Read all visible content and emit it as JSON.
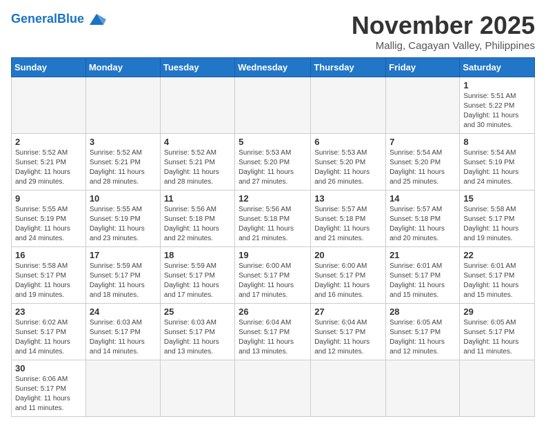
{
  "header": {
    "logo_general": "General",
    "logo_blue": "Blue",
    "month_title": "November 2025",
    "location": "Mallig, Cagayan Valley, Philippines"
  },
  "weekdays": [
    "Sunday",
    "Monday",
    "Tuesday",
    "Wednesday",
    "Thursday",
    "Friday",
    "Saturday"
  ],
  "days": {
    "d1": {
      "num": "1",
      "sunrise": "5:51 AM",
      "sunset": "5:22 PM",
      "daylight": "11 hours and 30 minutes."
    },
    "d2": {
      "num": "2",
      "sunrise": "5:52 AM",
      "sunset": "5:21 PM",
      "daylight": "11 hours and 29 minutes."
    },
    "d3": {
      "num": "3",
      "sunrise": "5:52 AM",
      "sunset": "5:21 PM",
      "daylight": "11 hours and 28 minutes."
    },
    "d4": {
      "num": "4",
      "sunrise": "5:52 AM",
      "sunset": "5:21 PM",
      "daylight": "11 hours and 28 minutes."
    },
    "d5": {
      "num": "5",
      "sunrise": "5:53 AM",
      "sunset": "5:20 PM",
      "daylight": "11 hours and 27 minutes."
    },
    "d6": {
      "num": "6",
      "sunrise": "5:53 AM",
      "sunset": "5:20 PM",
      "daylight": "11 hours and 26 minutes."
    },
    "d7": {
      "num": "7",
      "sunrise": "5:54 AM",
      "sunset": "5:20 PM",
      "daylight": "11 hours and 25 minutes."
    },
    "d8": {
      "num": "8",
      "sunrise": "5:54 AM",
      "sunset": "5:19 PM",
      "daylight": "11 hours and 24 minutes."
    },
    "d9": {
      "num": "9",
      "sunrise": "5:55 AM",
      "sunset": "5:19 PM",
      "daylight": "11 hours and 24 minutes."
    },
    "d10": {
      "num": "10",
      "sunrise": "5:55 AM",
      "sunset": "5:19 PM",
      "daylight": "11 hours and 23 minutes."
    },
    "d11": {
      "num": "11",
      "sunrise": "5:56 AM",
      "sunset": "5:18 PM",
      "daylight": "11 hours and 22 minutes."
    },
    "d12": {
      "num": "12",
      "sunrise": "5:56 AM",
      "sunset": "5:18 PM",
      "daylight": "11 hours and 21 minutes."
    },
    "d13": {
      "num": "13",
      "sunrise": "5:57 AM",
      "sunset": "5:18 PM",
      "daylight": "11 hours and 21 minutes."
    },
    "d14": {
      "num": "14",
      "sunrise": "5:57 AM",
      "sunset": "5:18 PM",
      "daylight": "11 hours and 20 minutes."
    },
    "d15": {
      "num": "15",
      "sunrise": "5:58 AM",
      "sunset": "5:17 PM",
      "daylight": "11 hours and 19 minutes."
    },
    "d16": {
      "num": "16",
      "sunrise": "5:58 AM",
      "sunset": "5:17 PM",
      "daylight": "11 hours and 19 minutes."
    },
    "d17": {
      "num": "17",
      "sunrise": "5:59 AM",
      "sunset": "5:17 PM",
      "daylight": "11 hours and 18 minutes."
    },
    "d18": {
      "num": "18",
      "sunrise": "5:59 AM",
      "sunset": "5:17 PM",
      "daylight": "11 hours and 17 minutes."
    },
    "d19": {
      "num": "19",
      "sunrise": "6:00 AM",
      "sunset": "5:17 PM",
      "daylight": "11 hours and 17 minutes."
    },
    "d20": {
      "num": "20",
      "sunrise": "6:00 AM",
      "sunset": "5:17 PM",
      "daylight": "11 hours and 16 minutes."
    },
    "d21": {
      "num": "21",
      "sunrise": "6:01 AM",
      "sunset": "5:17 PM",
      "daylight": "11 hours and 15 minutes."
    },
    "d22": {
      "num": "22",
      "sunrise": "6:01 AM",
      "sunset": "5:17 PM",
      "daylight": "11 hours and 15 minutes."
    },
    "d23": {
      "num": "23",
      "sunrise": "6:02 AM",
      "sunset": "5:17 PM",
      "daylight": "11 hours and 14 minutes."
    },
    "d24": {
      "num": "24",
      "sunrise": "6:03 AM",
      "sunset": "5:17 PM",
      "daylight": "11 hours and 14 minutes."
    },
    "d25": {
      "num": "25",
      "sunrise": "6:03 AM",
      "sunset": "5:17 PM",
      "daylight": "11 hours and 13 minutes."
    },
    "d26": {
      "num": "26",
      "sunrise": "6:04 AM",
      "sunset": "5:17 PM",
      "daylight": "11 hours and 13 minutes."
    },
    "d27": {
      "num": "27",
      "sunrise": "6:04 AM",
      "sunset": "5:17 PM",
      "daylight": "11 hours and 12 minutes."
    },
    "d28": {
      "num": "28",
      "sunrise": "6:05 AM",
      "sunset": "5:17 PM",
      "daylight": "11 hours and 12 minutes."
    },
    "d29": {
      "num": "29",
      "sunrise": "6:05 AM",
      "sunset": "5:17 PM",
      "daylight": "11 hours and 11 minutes."
    },
    "d30": {
      "num": "30",
      "sunrise": "6:06 AM",
      "sunset": "5:17 PM",
      "daylight": "11 hours and 11 minutes."
    }
  },
  "labels": {
    "sunrise": "Sunrise:",
    "sunset": "Sunset:",
    "daylight": "Daylight:"
  }
}
